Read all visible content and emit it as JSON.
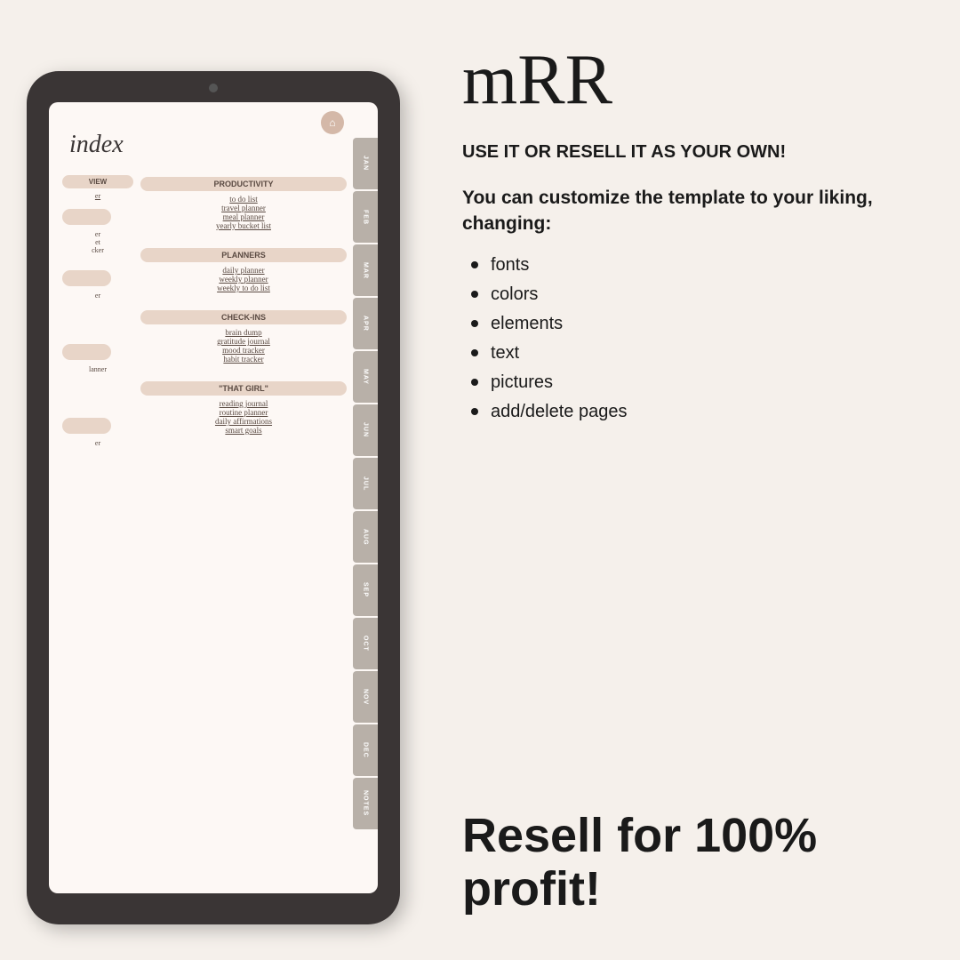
{
  "logo": {
    "text": "mRR",
    "style": "cursive"
  },
  "right_panel": {
    "tagline": "USE IT OR RESELL IT AS YOUR OWN!",
    "customize_heading": "You can customize the template to your liking, changing:",
    "bullet_items": [
      "fonts",
      "colors",
      "elements",
      "text",
      "pictures",
      "add/delete pages"
    ],
    "resell_line1": "Resell for 100%",
    "resell_line2": "profit!"
  },
  "tablet": {
    "index_title": "index",
    "home_icon": "⌂",
    "months": [
      "JAN",
      "FEB",
      "MAR",
      "APR",
      "MAY",
      "JUN",
      "JUL",
      "AUG",
      "SEP",
      "OCT",
      "NOV",
      "DEC",
      "NOTES"
    ],
    "left_col": {
      "sections": [
        {
          "badge": "VIEW",
          "items": [
            "er",
            "t",
            "cker"
          ]
        },
        {
          "badge": "",
          "items": [
            "er",
            "et",
            "cker"
          ]
        }
      ]
    },
    "right_col": {
      "sections": [
        {
          "badge": "PRODUCTIVITY",
          "items": [
            "to do list",
            "travel planner",
            "meal planner",
            "yearly bucket list"
          ]
        },
        {
          "badge": "PLANNERS",
          "items": [
            "daily planner",
            "weekly planner",
            "weekly to do list"
          ]
        },
        {
          "badge": "CHECK-INS",
          "items": [
            "brain dump",
            "gratitude journal",
            "mood tracker",
            "habit tracker"
          ]
        },
        {
          "badge": "\"THAT GIRL\"",
          "items": [
            "reading journal",
            "routine planner",
            "daily affirmations",
            "smart goals"
          ]
        }
      ]
    }
  },
  "colors": {
    "background": "#f5f0eb",
    "tablet_frame": "#3a3535",
    "screen_bg": "#fdf8f5",
    "badge_bg": "#e8d5c8",
    "text_dark": "#1a1a1a",
    "text_planner": "#5a4a42"
  }
}
